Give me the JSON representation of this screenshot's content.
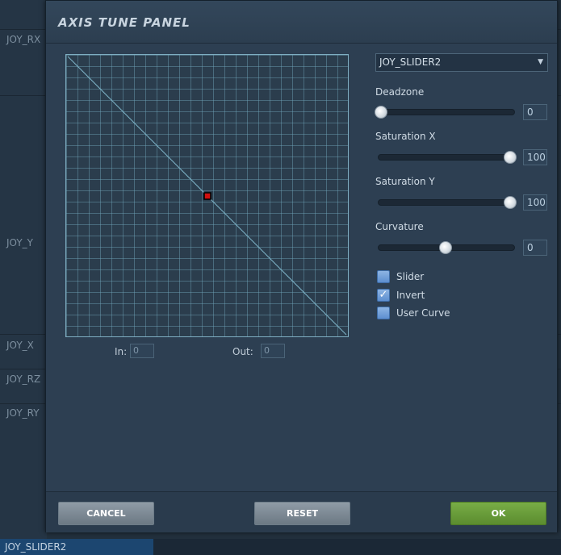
{
  "background": {
    "labels": [
      "JOY_RX",
      "JOY_Y",
      "JOY_X",
      "JOY_RZ",
      "JOY_RY"
    ],
    "selected_item": "JOY_SLIDER2"
  },
  "dialog": {
    "title": "AXIS TUNE PANEL",
    "in_label": "In:",
    "in_value": "0",
    "out_label": "Out:",
    "out_value": "0",
    "axis_select": "JOY_SLIDER2",
    "sliders": [
      {
        "label": "Deadzone",
        "value": "0",
        "level": 0
      },
      {
        "label": "Saturation X",
        "value": "100",
        "level": 100
      },
      {
        "label": "Saturation Y",
        "value": "100",
        "level": 100
      },
      {
        "label": "Curvature",
        "value": "0",
        "level": 50
      }
    ],
    "checkboxes": [
      {
        "label": "Slider",
        "checked": false
      },
      {
        "label": "Invert",
        "checked": true
      },
      {
        "label": "User Curve",
        "checked": false
      }
    ],
    "buttons": {
      "cancel": "CANCEL",
      "reset": "RESET",
      "ok": "OK"
    },
    "colors": {
      "ok_button": "#6a9e3b",
      "checkbox": "#6f9fdc",
      "grid_line": "#5f93a6",
      "marker": "#d01010"
    }
  }
}
